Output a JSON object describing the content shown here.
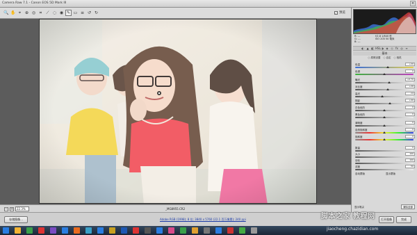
{
  "window": {
    "title": "Camera Raw 7.1 - Canon EOS 5D Mark III"
  },
  "toolbar": {
    "tools": [
      "zoom",
      "hand",
      "white-balance",
      "color-sampler",
      "target-adjust",
      "crop",
      "straighten",
      "spot-removal",
      "red-eye",
      "adjustment-brush",
      "graduated-filter",
      "preferences",
      "rotate-ccw",
      "rotate-cw"
    ],
    "preview_label": "预览",
    "preview_checked": true
  },
  "status": {
    "zoom_value": "22.3%",
    "filename": "_MG8955.CR2"
  },
  "bottom": {
    "save_button": "存储图像...",
    "workflow": "Adobe RGB (1998); 8 位; 3840 x 5760 (22.1 百万像素); 240 ppi",
    "open_button": "打开图像",
    "done_button": "完成"
  },
  "panel": {
    "rgb": {
      "r": "R: ---",
      "g": "G: ---",
      "b": "B: ---",
      "exposure_info": "f/2.8 1/640 秒",
      "iso_info": "ISO 200 50 毫米"
    },
    "section_title": "基本",
    "wb_options": [
      "原照设置",
      "自定",
      "相机"
    ],
    "sliders": [
      {
        "label": "色温",
        "value": "+20",
        "pos": 0.56,
        "track": "temp"
      },
      {
        "label": "色调",
        "value": "0",
        "pos": 0.5,
        "track": "tint"
      },
      {
        "label": "曝光",
        "value": "+0.70",
        "pos": 0.58,
        "track": "gray"
      },
      {
        "label": "对比度",
        "value": "+26",
        "pos": 0.56,
        "track": "gray"
      },
      {
        "label": "高光",
        "value": "-14",
        "pos": 0.46,
        "track": "gray"
      },
      {
        "label": "阴影",
        "value": "+40",
        "pos": 0.6,
        "track": "gray"
      },
      {
        "label": "白色色阶",
        "value": "0",
        "pos": 0.5,
        "track": "gray"
      },
      {
        "label": "黑色色阶",
        "value": "0",
        "pos": 0.5,
        "track": "gray"
      },
      {
        "label": "清晰度",
        "value": "0",
        "pos": 0.5,
        "track": "gray"
      },
      {
        "label": "自然饱和度",
        "value": "0",
        "pos": 0.5,
        "track": "sat"
      },
      {
        "label": "饱和度",
        "value": "0",
        "pos": 0.5,
        "track": "sat"
      }
    ],
    "extra_rows": [
      {
        "label": "数量",
        "value": "0"
      },
      {
        "label": "大小",
        "value": "100"
      },
      {
        "label": "羽化",
        "value": "100"
      },
      {
        "label": "浓度",
        "value": "50"
      }
    ],
    "checkboxes": [
      "自动蒙版",
      "显示蒙版"
    ],
    "foot_left": "显示笔尖",
    "foot_right": "清除全部"
  },
  "watermark": {
    "main": "脚本之家 教程网",
    "url": "jiaocheng.chazidian.com"
  }
}
